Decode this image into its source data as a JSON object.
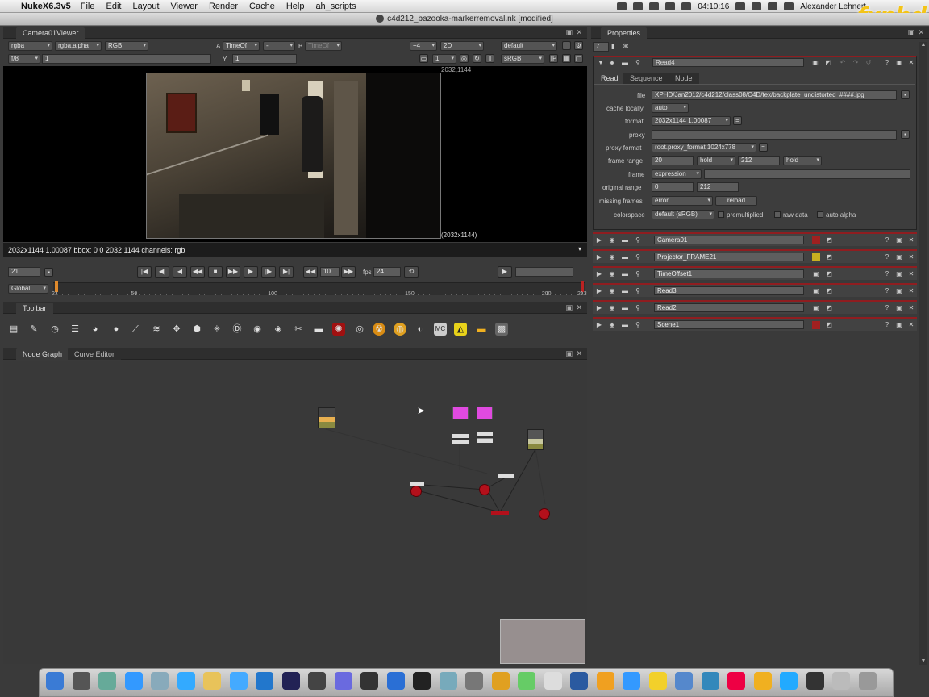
{
  "menubar": {
    "app_name": "NukeX6.3v5",
    "menus": [
      "File",
      "Edit",
      "Layout",
      "Viewer",
      "Render",
      "Cache",
      "Help",
      "ah_scripts"
    ],
    "clock": "04:10:16",
    "user": "Alexander Lehnert",
    "watermark": "fxphd"
  },
  "window": {
    "title": "c4d212_bazooka-markerremoval.nk [modified]"
  },
  "viewer": {
    "tab": "Camera01Viewer",
    "channels": "rgba",
    "alpha": "rgba.alpha",
    "colorspace_mode": "RGB",
    "a_label": "A",
    "a_input": "TimeOf",
    "compare_op": "-",
    "b_label": "B",
    "b_input": "TimeOf",
    "zoom": "+4",
    "view_mode": "2D",
    "lut_default": "default",
    "fstop": "f/8",
    "gain": "1",
    "gamma_label": "Y",
    "gamma": "1",
    "proxy": "1",
    "lut": "sRGB",
    "format_label": "2032,1144",
    "format_label_bottom": "(2032x1144)",
    "info": "2032x1144 1.00087  bbox: 0 0 2032 1144 channels: rgb"
  },
  "transport": {
    "frame": "21",
    "increment": "10",
    "fps_label": "fps",
    "fps": "24",
    "global": "Global",
    "ticks": [
      "21",
      "50",
      "100",
      "150",
      "200",
      "213"
    ],
    "tick_values": [
      21,
      50,
      100,
      150,
      200,
      213
    ],
    "range": [
      21,
      213
    ],
    "current_frame": 21
  },
  "toolbar_panel": {
    "tab": "Toolbar"
  },
  "node_graph": {
    "tabs": [
      "Node Graph",
      "Curve Editor"
    ]
  },
  "properties": {
    "tab": "Properties",
    "max_panels": "7",
    "read4": {
      "name": "Read4",
      "tabs": [
        "Read",
        "Sequence",
        "Node"
      ],
      "file_label": "file",
      "file": "XPHD/Jan2012/c4d212/class08/C4D/tex/backplate_undistorted_####.jpg",
      "cache_label": "cache locally",
      "cache": "auto",
      "format_label": "format",
      "format": "2032x1144 1.00087",
      "proxy_label": "proxy",
      "proxy_format_label": "proxy format",
      "proxy_format": "root.proxy_format 1024x778",
      "frame_range_label": "frame range",
      "frame_start": "20",
      "before": "hold",
      "frame_end": "212",
      "after": "hold",
      "frame_label": "frame",
      "frame_mode": "expression",
      "original_range_label": "original range",
      "orig_start": "0",
      "orig_end": "212",
      "missing_label": "missing frames",
      "missing": "error",
      "reload": "reload",
      "colorspace_label": "colorspace",
      "colorspace": "default (sRGB)",
      "premultiplied": "premultiplied",
      "raw_data": "raw data",
      "auto_alpha": "auto alpha"
    },
    "nodes": [
      "Camera01",
      "Projector_FRAME21",
      "TimeOffset1",
      "Read3",
      "Read2",
      "Scene1"
    ]
  },
  "dock": {
    "apps": [
      "Finder",
      "Dashboard",
      "Preview",
      "App Store",
      "Mail",
      "Safari",
      "Notes",
      "iTunes",
      "Earth",
      "Cinema",
      "Pen",
      "AE",
      "FCP",
      "Ps",
      "Aperture",
      "iPhoto",
      "Script",
      "Photo",
      "Sys",
      "Mon",
      "Word",
      "Nuke",
      "Twitter",
      "Duck",
      "Wave",
      "Search",
      "Audio",
      "Bomb",
      "Skype",
      "Screen",
      "Util",
      "Trash"
    ]
  }
}
